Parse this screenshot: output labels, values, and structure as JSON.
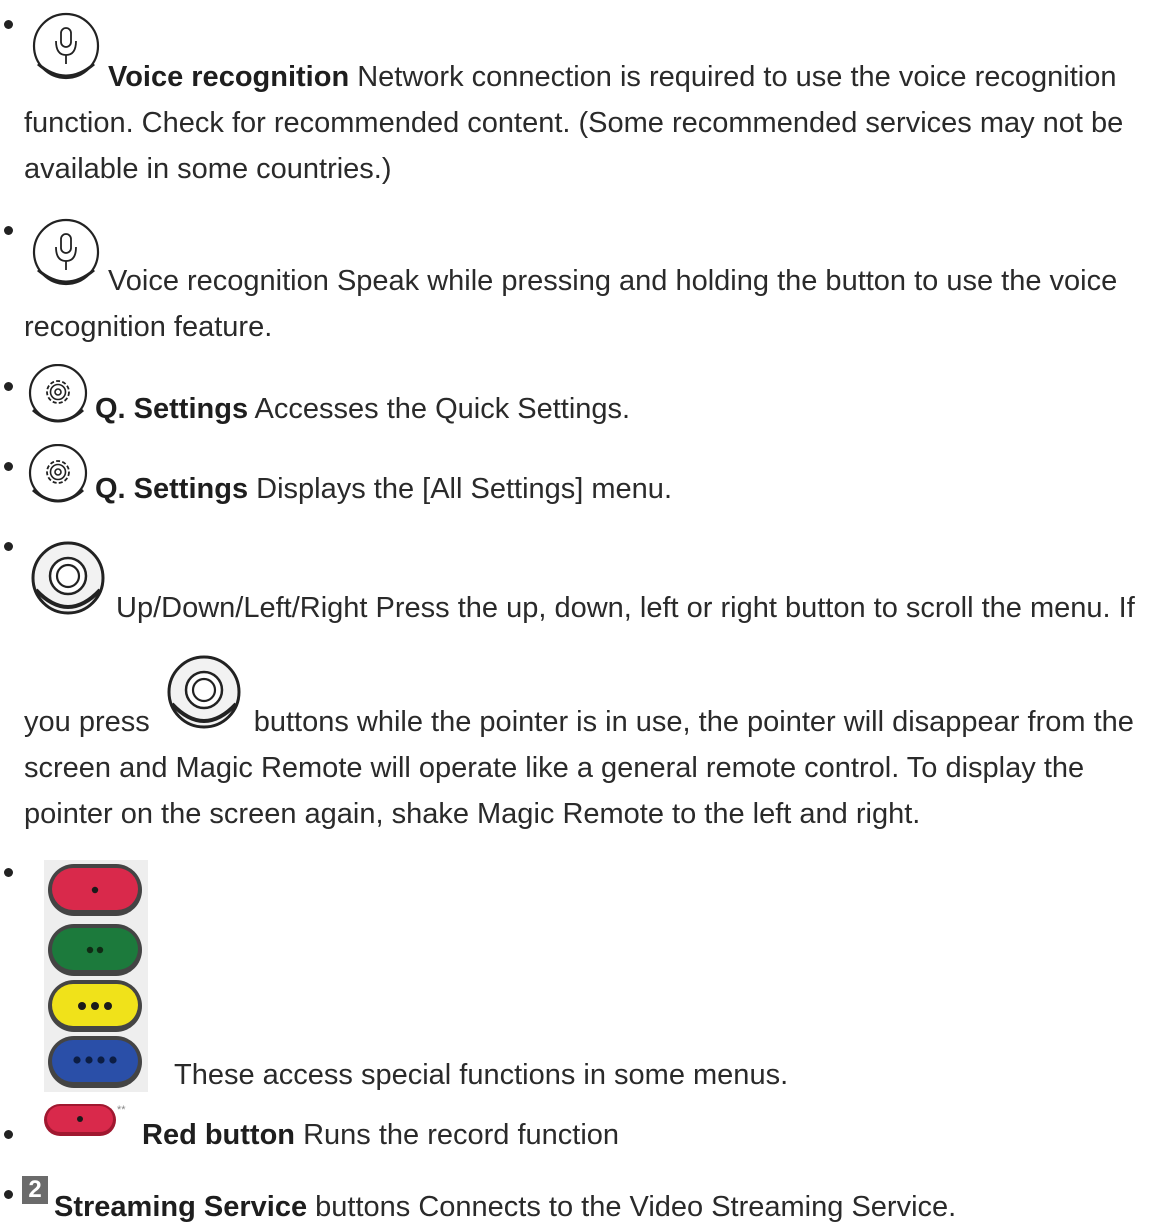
{
  "items": [
    {
      "icon": "microphone-icon",
      "label": "Voice recognition",
      "l1": "Network connection is required to use the voice recognition",
      "l2": "function. Check for recommended content. (Some recommended services may not be",
      "l3": "available in some countries.)"
    },
    {
      "icon": "microphone-icon",
      "label": "Voice recognition",
      "l1": "Speak while pressing and holding the button to use the voice",
      "l2": "recognition feature."
    },
    {
      "icon": "gear-icon",
      "label": "Q. Settings",
      "text": "Accesses the Quick Settings."
    },
    {
      "icon": "gear-icon",
      "label": "Q. Settings",
      "text": "Displays the [All Settings] menu."
    },
    {
      "icon": "navigation-wheel-icon",
      "label": "Up/Down/Left/Right",
      "l1": "Press the up, down, left or right button to scroll the menu. If",
      "l2a": "you press",
      "l2b": "buttons while the pointer is in use, the pointer will disappear from the",
      "l3": "screen and Magic Remote will operate like a general remote control. To display the",
      "l4": "pointer on the screen again, shake Magic Remote to the left and right."
    },
    {
      "icon": "color-buttons-icon",
      "colors": [
        "#d9294b",
        "#1c7a3c",
        "#f0e21a",
        "#2a4fa8"
      ],
      "text": "These access special functions in some menus."
    },
    {
      "icon": "red-button-icon",
      "color": "#d9294b",
      "mark": "**",
      "label": "Red button",
      "text": "Runs the record function"
    },
    {
      "icon": "streaming-2-icon",
      "glyph": "2",
      "label": "Streaming Service",
      "text": "buttons Connects to the Video Streaming Service."
    }
  ]
}
